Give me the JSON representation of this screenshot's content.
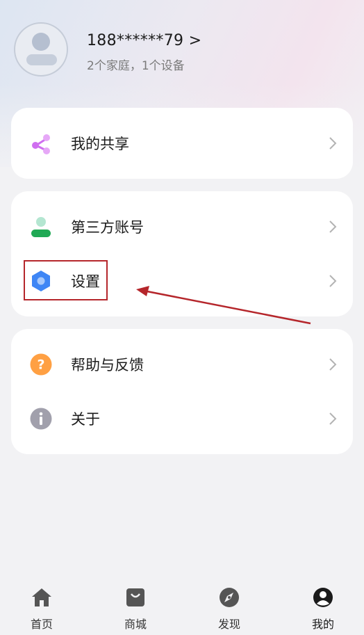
{
  "profile": {
    "phone": "188******79 >",
    "subinfo": "2个家庭，1个设备"
  },
  "menu": {
    "share_label": "我的共享",
    "third_party_label": "第三方账号",
    "settings_label": "设置",
    "help_label": "帮助与反馈",
    "about_label": "关于"
  },
  "bottom_nav": {
    "home": "首页",
    "mall": "商城",
    "discover": "发现",
    "mine": "我的"
  },
  "colors": {
    "share_icon": "#cf6ff0",
    "third_party_head": "#b4e6d1",
    "third_party_body": "#20a955",
    "settings_icon": "#3e86f5",
    "help_icon": "#ffa043",
    "about_icon": "#a1a0ac",
    "annotation": "#b5262b"
  },
  "icons": {
    "avatar": "user-silhouette-icon",
    "share": "share-icon",
    "third_party": "account-icon",
    "settings": "hexagon-settings-icon",
    "help": "question-icon",
    "about": "info-icon",
    "chevron": "chevron-right-icon",
    "home": "home-icon",
    "mall": "shopping-bag-icon",
    "discover": "compass-icon",
    "mine": "user-circle-icon"
  }
}
